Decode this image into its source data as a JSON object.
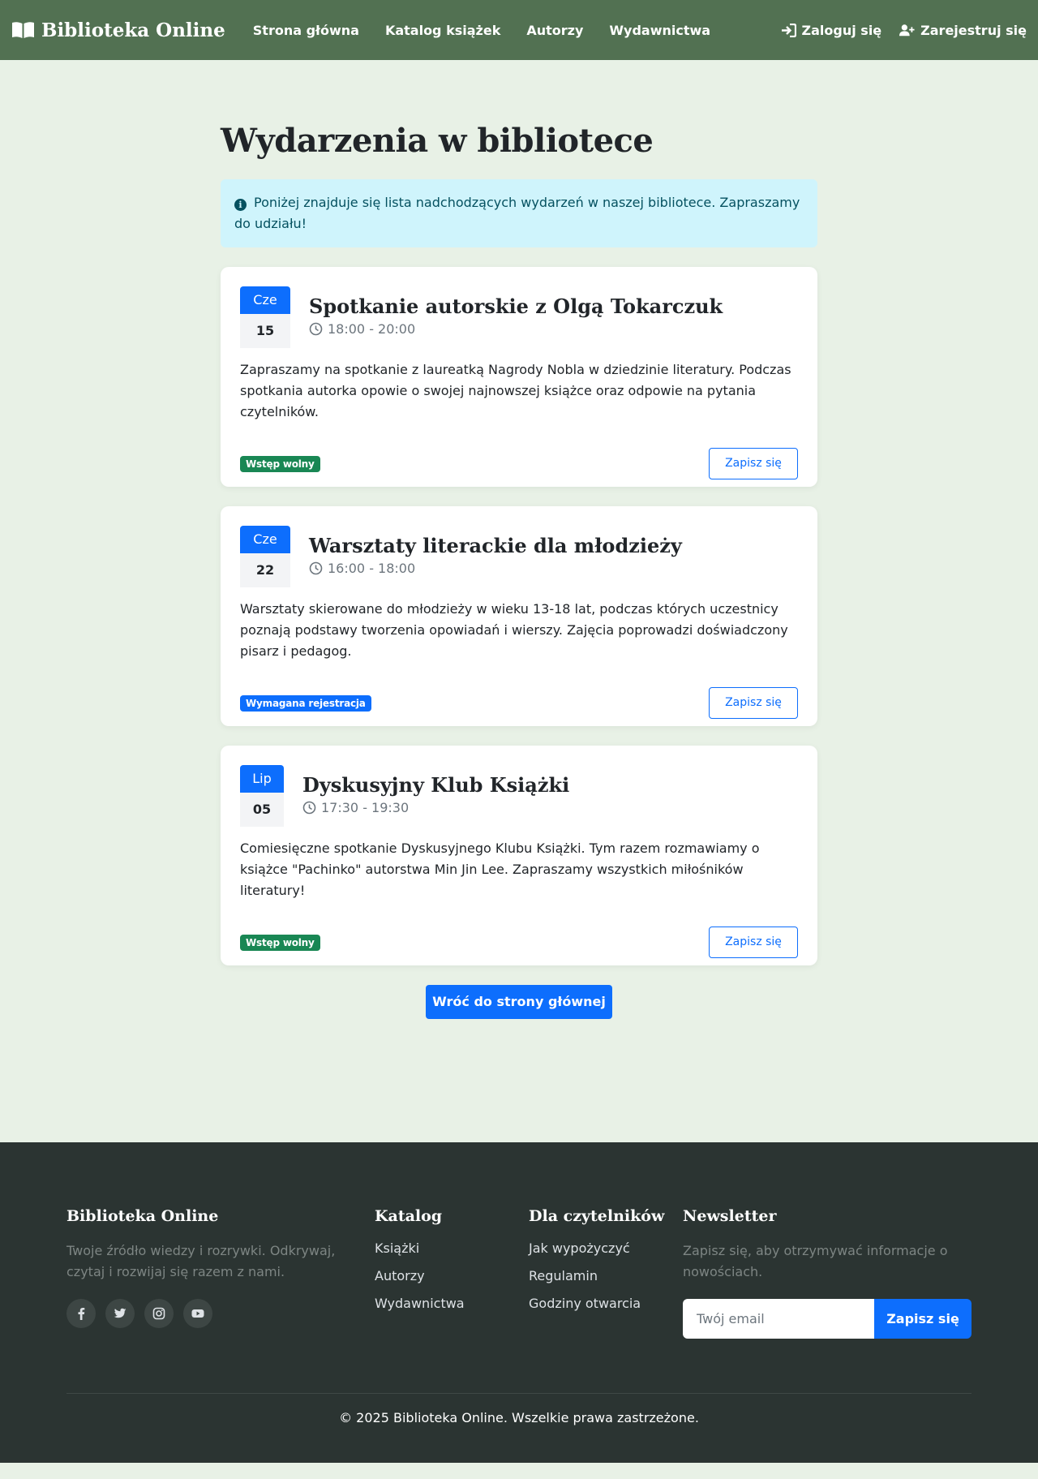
{
  "navbar": {
    "brand": "Biblioteka Online",
    "links": [
      "Strona główna",
      "Katalog książek",
      "Autorzy",
      "Wydawnictwa"
    ],
    "login": "Zaloguj się",
    "register": "Zarejestruj się"
  },
  "main": {
    "title": "Wydarzenia w bibliotece",
    "alert": "Poniżej znajduje się lista nadchodzących wydarzeń w naszej bibliotece. Zapraszamy do udziału!",
    "events": [
      {
        "month": "Cze",
        "day": "15",
        "title": "Spotkanie autorskie z Olgą Tokarczuk",
        "time": "18:00 - 20:00",
        "description": "Zapraszamy na spotkanie z laureatką Nagrody Nobla w dziedzinie literatury. Podczas spotkania autorka opowie o swojej najnowszej książce oraz odpowie na pytania czytelników.",
        "badge": "Wstęp wolny",
        "badge_color": "#198754",
        "button": "Zapisz się"
      },
      {
        "month": "Cze",
        "day": "22",
        "title": "Warsztaty literackie dla młodzieży",
        "time": "16:00 - 18:00",
        "description": "Warsztaty skierowane do młodzieży w wieku 13-18 lat, podczas których uczestnicy poznają podstawy tworzenia opowiadań i wierszy. Zajęcia poprowadzi doświadczony pisarz i pedagog.",
        "badge": "Wymagana rejestracja",
        "badge_color": "#0d6efd",
        "button": "Zapisz się"
      },
      {
        "month": "Lip",
        "day": "05",
        "title": "Dyskusyjny Klub Książki",
        "time": "17:30 - 19:30",
        "description": "Comiesięczne spotkanie Dyskusyjnego Klubu Książki. Tym razem rozmawiamy o książce \"Pachinko\" autorstwa Min Jin Lee. Zapraszamy wszystkich miłośników literatury!",
        "badge": "Wstęp wolny",
        "badge_color": "#198754",
        "button": "Zapisz się"
      }
    ],
    "back_button": "Wróć do strony głównej"
  },
  "footer": {
    "about_title": "Biblioteka Online",
    "about_text": "Twoje źródło wiedzy i rozrywki. Odkrywaj, czytaj i rozwijaj się razem z nami.",
    "socials": [
      "facebook-icon",
      "twitter-icon",
      "instagram-icon",
      "youtube-icon"
    ],
    "catalog_title": "Katalog",
    "catalog_links": [
      "Książki",
      "Autorzy",
      "Wydawnictwa"
    ],
    "readers_title": "Dla czytelników",
    "readers_links": [
      "Jak wypożyczyć",
      "Regulamin",
      "Godziny otwarcia"
    ],
    "newsletter_title": "Newsletter",
    "newsletter_text": "Zapisz się, aby otrzymywać informacje o nowościach.",
    "email_placeholder": "Twój email",
    "newsletter_button": "Zapisz się",
    "copyright": "© 2025 Biblioteka Online. Wszelkie prawa zastrzeżone."
  },
  "colors": {
    "navbar": "#527152",
    "page_bg": "#e8f1e6",
    "primary": "#0d6efd",
    "footer_bg": "#2b3432",
    "alert_bg": "#cff4fc"
  }
}
